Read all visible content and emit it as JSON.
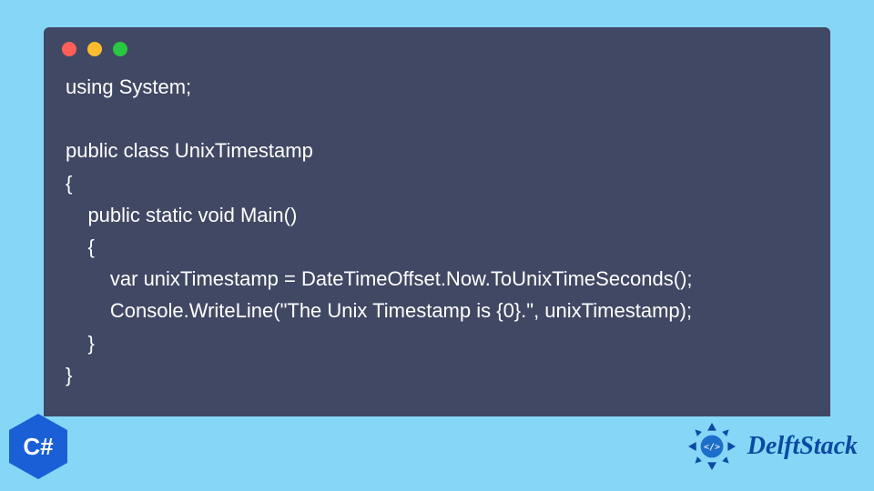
{
  "code": {
    "lines": [
      "using System;",
      "",
      "public class UnixTimestamp",
      "{",
      "    public static void Main()",
      "    {",
      "        var unixTimestamp = DateTimeOffset.Now.ToUnixTimeSeconds();",
      "        Console.WriteLine(\"The Unix Timestamp is {0}.\", unixTimestamp);",
      "    }",
      "}"
    ]
  },
  "language_badge": {
    "label": "C#"
  },
  "brand": {
    "name": "DelftStack"
  },
  "colors": {
    "page_bg": "#86d6f7",
    "code_bg": "#414863",
    "code_fg": "#ffffff",
    "brand_text": "#0b4aa2",
    "badge_bg": "#1a5fd6"
  }
}
